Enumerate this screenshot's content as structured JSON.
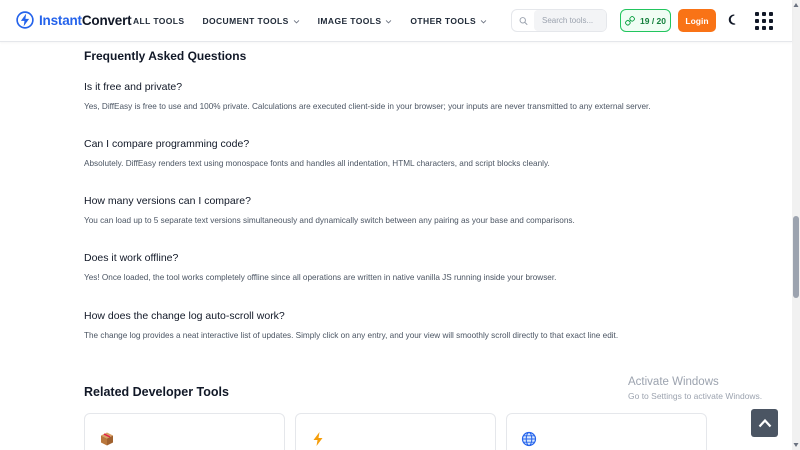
{
  "header": {
    "brand_part1": "Instant",
    "brand_part2": "Convert",
    "nav": [
      {
        "label": "ALL TOOLS",
        "has_dropdown": false
      },
      {
        "label": "DOCUMENT TOOLS",
        "has_dropdown": true
      },
      {
        "label": "IMAGE TOOLS",
        "has_dropdown": true
      },
      {
        "label": "OTHER TOOLS",
        "has_dropdown": true
      }
    ],
    "search_placeholder": "Search tools...",
    "counter": "19 / 20",
    "login_label": "Login",
    "icons": {
      "brand": "lightning-bolt-icon",
      "search": "search-icon",
      "counter": "link-icon",
      "theme": "moon-icon",
      "apps": "apps-grid-icon"
    }
  },
  "faq": {
    "title": "Frequently Asked Questions",
    "items": [
      {
        "q": "Is it free and private?",
        "a": "Yes, DiffEasy is free to use and 100% private. Calculations are executed client-side in your browser; your inputs are never transmitted to any external server."
      },
      {
        "q": "Can I compare programming code?",
        "a": "Absolutely. DiffEasy renders text using monospace fonts and handles all indentation, HTML characters, and script blocks cleanly."
      },
      {
        "q": "How many versions can I compare?",
        "a": "You can load up to 5 separate text versions simultaneously and dynamically switch between any pairing as your base and comparisons."
      },
      {
        "q": "Does it work offline?",
        "a": "Yes! Once loaded, the tool works completely offline since all operations are written in native vanilla JS running inside your browser."
      },
      {
        "q": "How does the change log auto-scroll work?",
        "a": "The change log provides a neat interactive list of updates. Simply click on any entry, and your view will smoothly scroll directly to that exact line edit."
      }
    ]
  },
  "related": {
    "title": "Related Developer Tools",
    "cards": [
      {
        "icon": "package-icon"
      },
      {
        "icon": "lightning-icon"
      },
      {
        "icon": "globe-icon"
      }
    ]
  },
  "watermark": {
    "title": "Activate Windows",
    "subtitle": "Go to Settings to activate Windows."
  },
  "colors": {
    "brand_blue": "#2563eb",
    "login_orange": "#f97316",
    "counter_green": "#22c55e"
  }
}
